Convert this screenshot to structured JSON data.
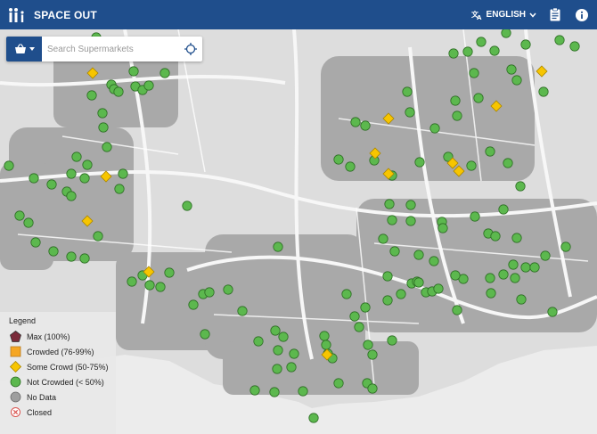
{
  "app": {
    "title": "SPACE OUT"
  },
  "header": {
    "language_label": "ENGLISH"
  },
  "search": {
    "placeholder": "Search Supermarkets"
  },
  "legend": {
    "title": "Legend",
    "items": [
      {
        "label": "Max (100%)",
        "status": "max",
        "color": "#7a2b3a"
      },
      {
        "label": "Crowded (76-99%)",
        "status": "crowded",
        "color": "#f5a623"
      },
      {
        "label": "Some Crowd (50-75%)",
        "status": "some",
        "color": "#f7c500"
      },
      {
        "label": "Not Crowded (< 50%)",
        "status": "not",
        "color": "#5cb84e"
      },
      {
        "label": "No Data",
        "status": "nodata",
        "color": "#9e9e9e"
      },
      {
        "label": "Closed",
        "status": "closed",
        "color": "#d9534f"
      }
    ]
  },
  "colors": {
    "header": "#1f4e8c",
    "green_marker": "#5cb84e",
    "yellow_marker": "#f7c500"
  },
  "icons": {
    "brand": "family-icon",
    "language": "translate-icon",
    "clipboard": "clipboard-icon",
    "info": "info-icon",
    "store": "basket-icon",
    "locate": "crosshair-icon"
  }
}
